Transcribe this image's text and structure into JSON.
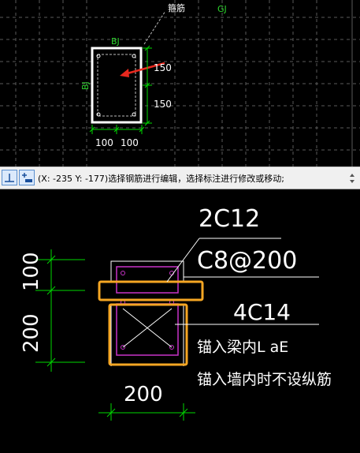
{
  "top_view": {
    "callout_label": "箍筋",
    "gj_label": "GJ",
    "bj_top_label": "BJ",
    "bj_side_label": "BJ",
    "dim_right_upper": "150",
    "dim_right_lower": "150",
    "dim_bottom_left": "100",
    "dim_bottom_right": "100"
  },
  "status_bar": {
    "prompt_text": "(X: -235 Y: -177)选择钢筋进行编辑，选择标注进行修改或移动;",
    "snap_button_icon": "perpendicular-snap-icon",
    "ortho_button_icon": "ortho-plus-icon"
  },
  "detail_view": {
    "top_bar_label": "2C12",
    "stirrup_label": "C8@200",
    "bottom_bar_label": "4C14",
    "dim_left_upper": "100",
    "dim_left_lower": "200",
    "dim_bottom": "200",
    "note_line1": "锚入梁内L aE",
    "note_line2": "锚入墙内时不设纵筋"
  },
  "colors": {
    "dim_green": "#00d700",
    "highlight_orange": "#f5a623",
    "rebar_magenta": "#c832c8",
    "arrow_red": "#e8281e",
    "label_green": "#2dd42d"
  }
}
